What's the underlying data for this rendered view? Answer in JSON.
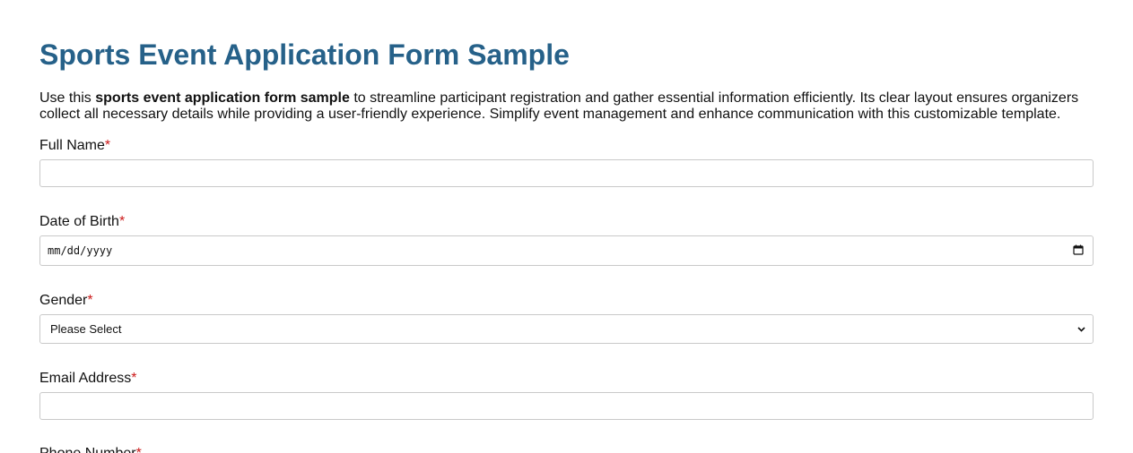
{
  "page": {
    "title": "Sports Event Application Form Sample",
    "intro": {
      "before": "Use this ",
      "bold": "sports event application form sample",
      "after": " to streamline participant registration and gather essential information efficiently. Its clear layout ensures organizers collect all necessary details while providing a user-friendly experience. Simplify event management and enhance communication with this customizable template."
    }
  },
  "form": {
    "required_marker": "*",
    "full_name": {
      "label": "Full Name",
      "value": ""
    },
    "date_of_birth": {
      "label": "Date of Birth",
      "placeholder": "mm/dd/yyyy",
      "icon": "calendar-icon"
    },
    "gender": {
      "label": "Gender",
      "selected": "Please Select",
      "icon": "chevron-down-icon"
    },
    "email": {
      "label": "Email Address",
      "value": ""
    },
    "phone": {
      "label": "Phone Number"
    }
  },
  "colors": {
    "title": "#266189",
    "required": "#cc1a1a",
    "input_border": "#c9c9c9"
  }
}
